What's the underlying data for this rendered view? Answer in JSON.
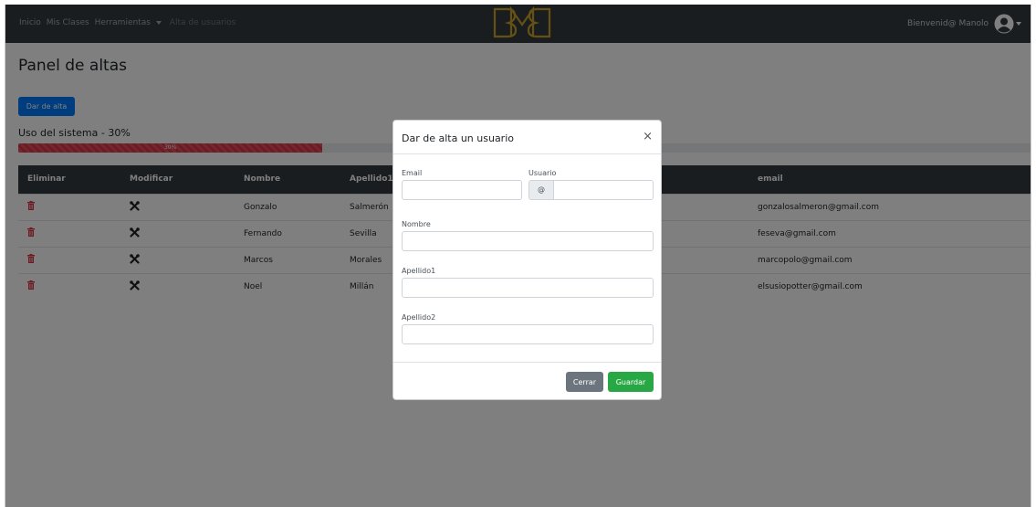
{
  "navbar": {
    "links": [
      "Inicio",
      "Mis Clases",
      "Herramientas",
      "Alta de usuarios"
    ],
    "logo_text": "BMB",
    "greeting": "Bienvenid@ Manolo"
  },
  "page": {
    "title": "Panel de altas",
    "add_button": "Dar de alta",
    "usage_label": "Uso del sistema - 30%",
    "usage_value": 30,
    "usage_bar_text": "30%"
  },
  "table": {
    "headers": [
      "Eliminar",
      "Modificar",
      "Nombre",
      "Apellido1",
      "email"
    ],
    "rows": [
      {
        "nombre": "Gonzalo",
        "apellido1": "Salmerón",
        "email": "gonzalosalmeron@gmail.com"
      },
      {
        "nombre": "Fernando",
        "apellido1": "Sevilla",
        "email": "feseva@gmail.com"
      },
      {
        "nombre": "Marcos",
        "apellido1": "Morales",
        "email": "marcopolo@gmail.com"
      },
      {
        "nombre": "Noel",
        "apellido1": "Millán",
        "email": "elsusiopotter@gmail.com"
      }
    ]
  },
  "modal": {
    "title": "Dar de alta un usuario",
    "close": "×",
    "email_label": "Email",
    "usuario_label": "Usuario",
    "usuario_prepend": "@",
    "nombre_label": "Nombre",
    "apellido1_label": "Apellido1",
    "apellido2_label": "Apellido2",
    "email_value": "",
    "usuario_value": "",
    "nombre_value": "",
    "apellido1_value": "",
    "apellido2_value": "",
    "cancel_button": "Cerrar",
    "save_button": "Guardar"
  },
  "colors": {
    "navbar": "#343a40",
    "primary": "#007bff",
    "danger": "#dc3545",
    "success": "#28a745",
    "secondary": "#6c757d",
    "logo": "#c9a227"
  }
}
